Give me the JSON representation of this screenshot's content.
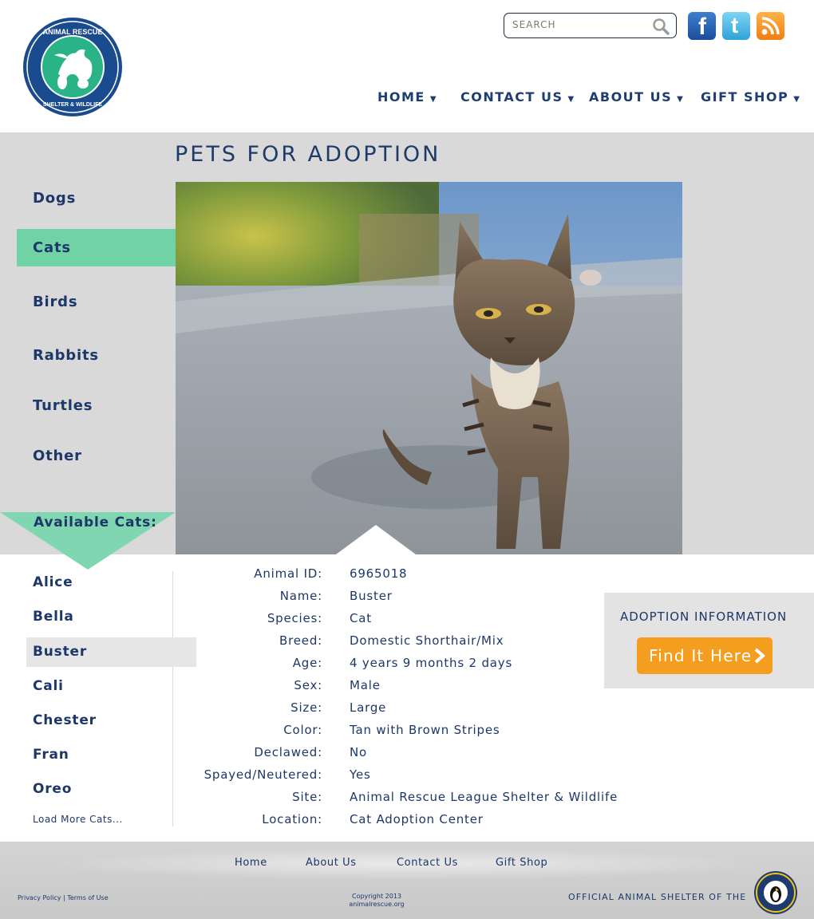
{
  "header": {
    "logo_text": "ANIMAL RESCUE LEAGUE SHELTER & WILDLIFE CENTER",
    "search_placeholder": "SEARCH",
    "social": {
      "facebook": "f",
      "twitter": "t"
    },
    "nav": [
      {
        "label": "HOME"
      },
      {
        "label": "CONTACT US"
      },
      {
        "label": "ABOUT US"
      },
      {
        "label": "GIFT SHOP"
      }
    ]
  },
  "page_title": "PETS FOR ADOPTION",
  "sidebar": {
    "categories": [
      "Dogs",
      "Cats",
      "Birds",
      "Rabbits",
      "Turtles",
      "Other"
    ],
    "active_category": "Cats",
    "available_label": "Available Cats:",
    "names": [
      "Alice",
      "Bella",
      "Buster",
      "Cali",
      "Chester",
      "Fran",
      "Oreo"
    ],
    "active_name": "Buster",
    "load_more": "Load More Cats..."
  },
  "details": [
    {
      "label": "Animal ID:",
      "value": "6965018"
    },
    {
      "label": "Name:",
      "value": "Buster"
    },
    {
      "label": "Species:",
      "value": "Cat"
    },
    {
      "label": "Breed:",
      "value": "Domestic Shorthair/Mix"
    },
    {
      "label": "Age:",
      "value": "4 years 9 months 2 days"
    },
    {
      "label": "Sex:",
      "value": "Male"
    },
    {
      "label": "Size:",
      "value": "Large"
    },
    {
      "label": "Color:",
      "value": "Tan with Brown Stripes"
    },
    {
      "label": "Declawed:",
      "value": "No"
    },
    {
      "label": "Spayed/Neutered:",
      "value": "Yes"
    },
    {
      "label": "Site:",
      "value": "Animal Rescue League Shelter & Wildlife"
    },
    {
      "label": "Location:",
      "value": "Cat Adoption Center"
    }
  ],
  "adoption": {
    "title": "ADOPTION INFORMATION",
    "button": "Find It Here"
  },
  "footer": {
    "links": [
      "Home",
      "About Us",
      "Contact Us",
      "Gift Shop"
    ],
    "privacy": "Privacy Policy",
    "separator": "|",
    "terms": "Terms of Use",
    "copyright_line1": "Copyright 2013",
    "copyright_line2": "animalrescue.org",
    "official": "OFFICIAL ANIMAL SHELTER OF THE",
    "penguins_text": "PITTSBURGH PENGUINS"
  },
  "colors": {
    "navy": "#1d3868",
    "accent_green": "#6fd3a5",
    "orange": "#f59d1e",
    "gray_bg": "#d9d9d9"
  }
}
